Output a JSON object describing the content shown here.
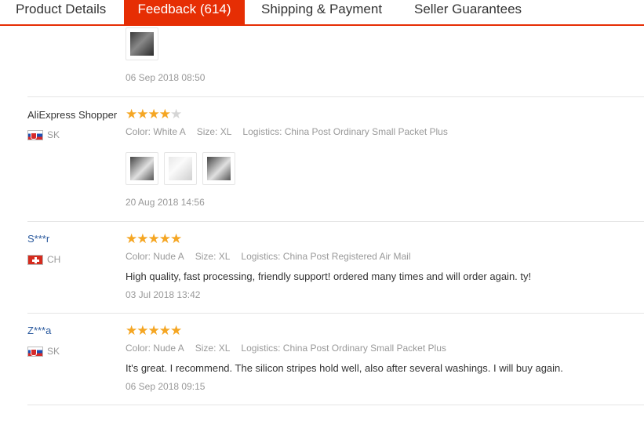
{
  "tabs": [
    {
      "label": "Product Details",
      "active": false
    },
    {
      "label": "Feedback (614)",
      "active": true
    },
    {
      "label": "Shipping & Payment",
      "active": false
    },
    {
      "label": "Seller Guarantees",
      "active": false
    }
  ],
  "colors": {
    "accent": "#e62e04",
    "star": "#f5a623",
    "link": "#2b5a9e"
  },
  "reviews": [
    {
      "date": "06 Sep 2018 08:50",
      "photos": [
        "review-photo"
      ]
    },
    {
      "user": "AliExpress Shopper",
      "country": "SK",
      "rating": 4,
      "color": "Color: White A",
      "size": "Size: XL",
      "logistics": "Logistics: China Post Ordinary Small Packet Plus",
      "photos": [
        "review-photo",
        "review-photo",
        "review-photo"
      ],
      "date": "20 Aug 2018 14:56"
    },
    {
      "user": "S***r",
      "country": "CH",
      "rating": 5,
      "color": "Color: Nude A",
      "size": "Size: XL",
      "logistics": "Logistics: China Post Registered Air Mail",
      "text": "High quality, fast processing, friendly support! ordered many times and will order again. ty!",
      "date": "03 Jul 2018 13:42"
    },
    {
      "user": "Z***a",
      "country": "SK",
      "rating": 5,
      "color": "Color: Nude A",
      "size": "Size: XL",
      "logistics": "Logistics: China Post Ordinary Small Packet Plus",
      "text": "It's great. I recommend. The silicon stripes hold well, also after several washings. I will buy again.",
      "date": "06 Sep 2018 09:15"
    }
  ]
}
